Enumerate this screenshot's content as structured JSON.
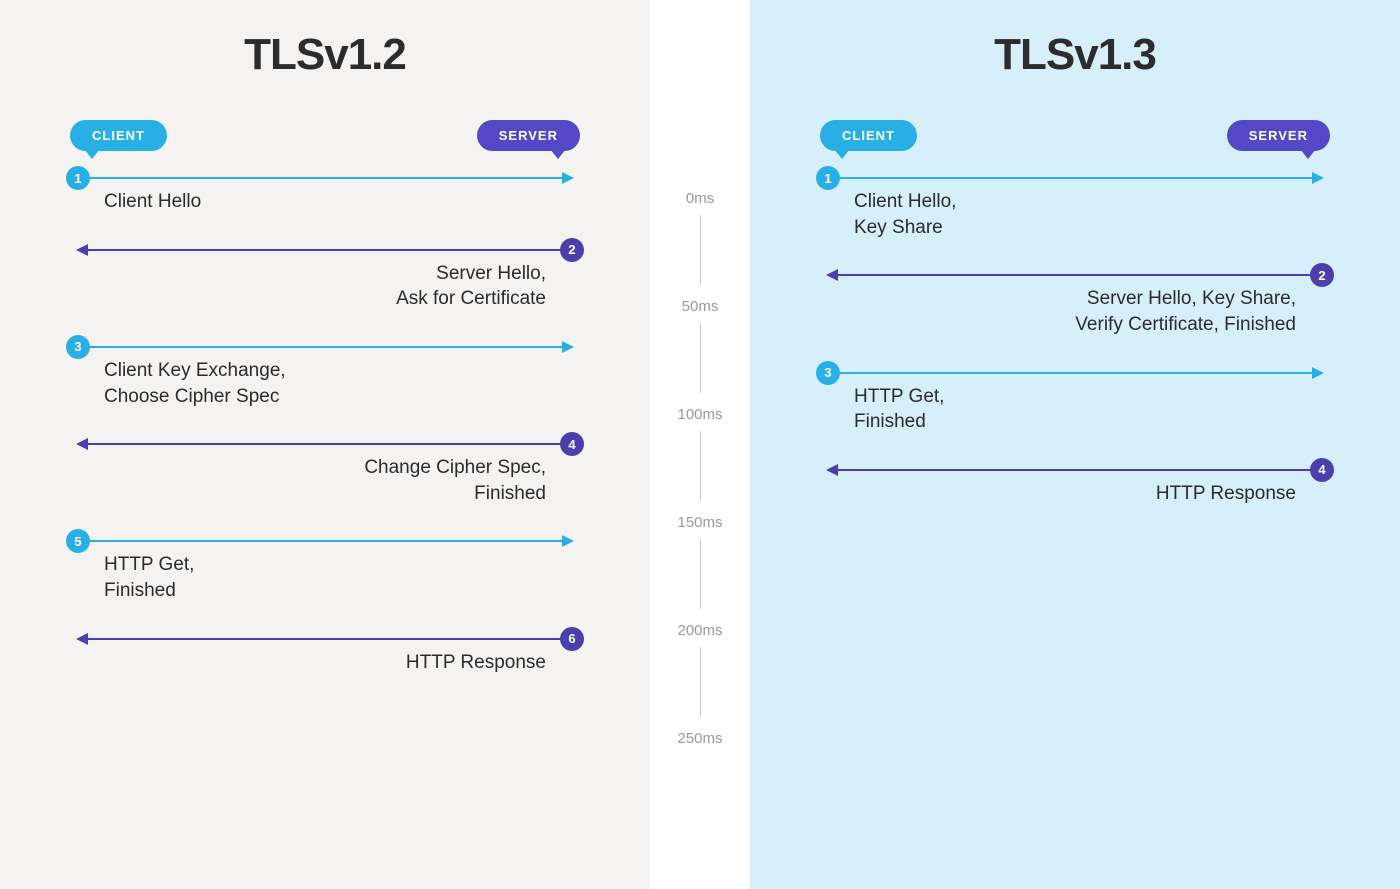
{
  "colors": {
    "client": "#28b0e6",
    "server": "#4b3fae",
    "server_badge": "#5548c7",
    "left_bg": "#f4f3f2",
    "right_bg": "#d7effa"
  },
  "roles": {
    "client": "CLIENT",
    "server": "SERVER"
  },
  "timeline": [
    "0ms",
    "50ms",
    "100ms",
    "150ms",
    "200ms",
    "250ms"
  ],
  "left": {
    "title": "TLSv1.2",
    "steps": [
      {
        "n": "1",
        "dir": "client",
        "label": "Client Hello"
      },
      {
        "n": "2",
        "dir": "server",
        "label": "Server Hello,\nAsk for Certificate"
      },
      {
        "n": "3",
        "dir": "client",
        "label": "Client Key Exchange,\nChoose Cipher Spec"
      },
      {
        "n": "4",
        "dir": "server",
        "label": "Change Cipher Spec,\nFinished"
      },
      {
        "n": "5",
        "dir": "client",
        "label": "HTTP Get,\nFinished"
      },
      {
        "n": "6",
        "dir": "server",
        "label": "HTTP Response"
      }
    ]
  },
  "right": {
    "title": "TLSv1.3",
    "steps": [
      {
        "n": "1",
        "dir": "client",
        "label": "Client Hello,\nKey Share"
      },
      {
        "n": "2",
        "dir": "server",
        "label": "Server Hello, Key Share,\nVerify Certificate, Finished"
      },
      {
        "n": "3",
        "dir": "client",
        "label": "HTTP Get,\nFinished"
      },
      {
        "n": "4",
        "dir": "server",
        "label": "HTTP Response"
      }
    ]
  }
}
